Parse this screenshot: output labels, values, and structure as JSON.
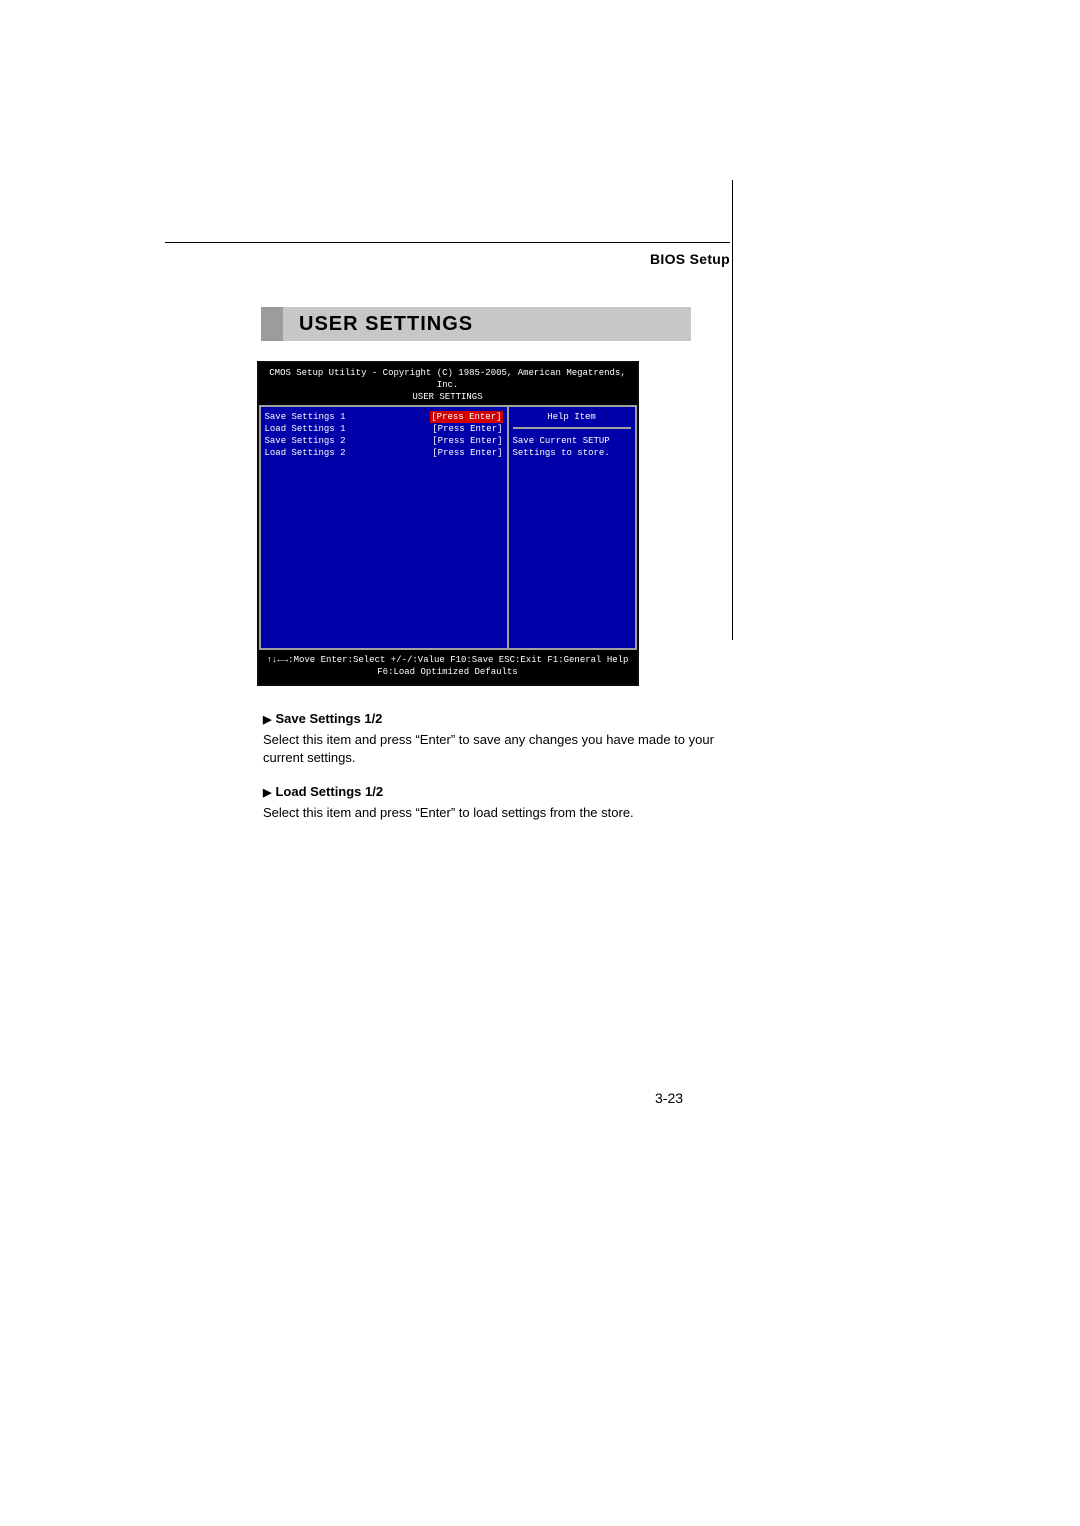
{
  "header": {
    "label": "BIOS Setup",
    "title": "USER SETTINGS"
  },
  "bios": {
    "header_line1": "CMOS Setup Utility - Copyright (C) 1985-2005, American Megatrends, Inc.",
    "header_line2": "USER SETTINGS",
    "items": [
      {
        "label": "Save Settings 1",
        "value": "[Press Enter]",
        "selected": true
      },
      {
        "label": "Load Settings 1",
        "value": "[Press Enter]",
        "selected": false
      },
      {
        "label": "Save Settings 2",
        "value": "[Press Enter]",
        "selected": false
      },
      {
        "label": "Load Settings 2",
        "value": "[Press Enter]",
        "selected": false
      }
    ],
    "help_title": "Help Item",
    "help_text1": "Save Current SETUP",
    "help_text2": "Settings to store.",
    "footer_line1": "↑↓←→:Move  Enter:Select  +/-/:Value  F10:Save  ESC:Exit  F1:General Help",
    "footer_line2": "F6:Load Optimized Defaults"
  },
  "doc": {
    "item1_title": "Save Settings 1/2",
    "item1_body": "Select this item and press “Enter” to save any changes you have made to your current settings.",
    "item2_title": "Load Settings 1/2",
    "item2_body": "Select this item and press “Enter” to load settings from the store."
  },
  "page_number": "3-23"
}
